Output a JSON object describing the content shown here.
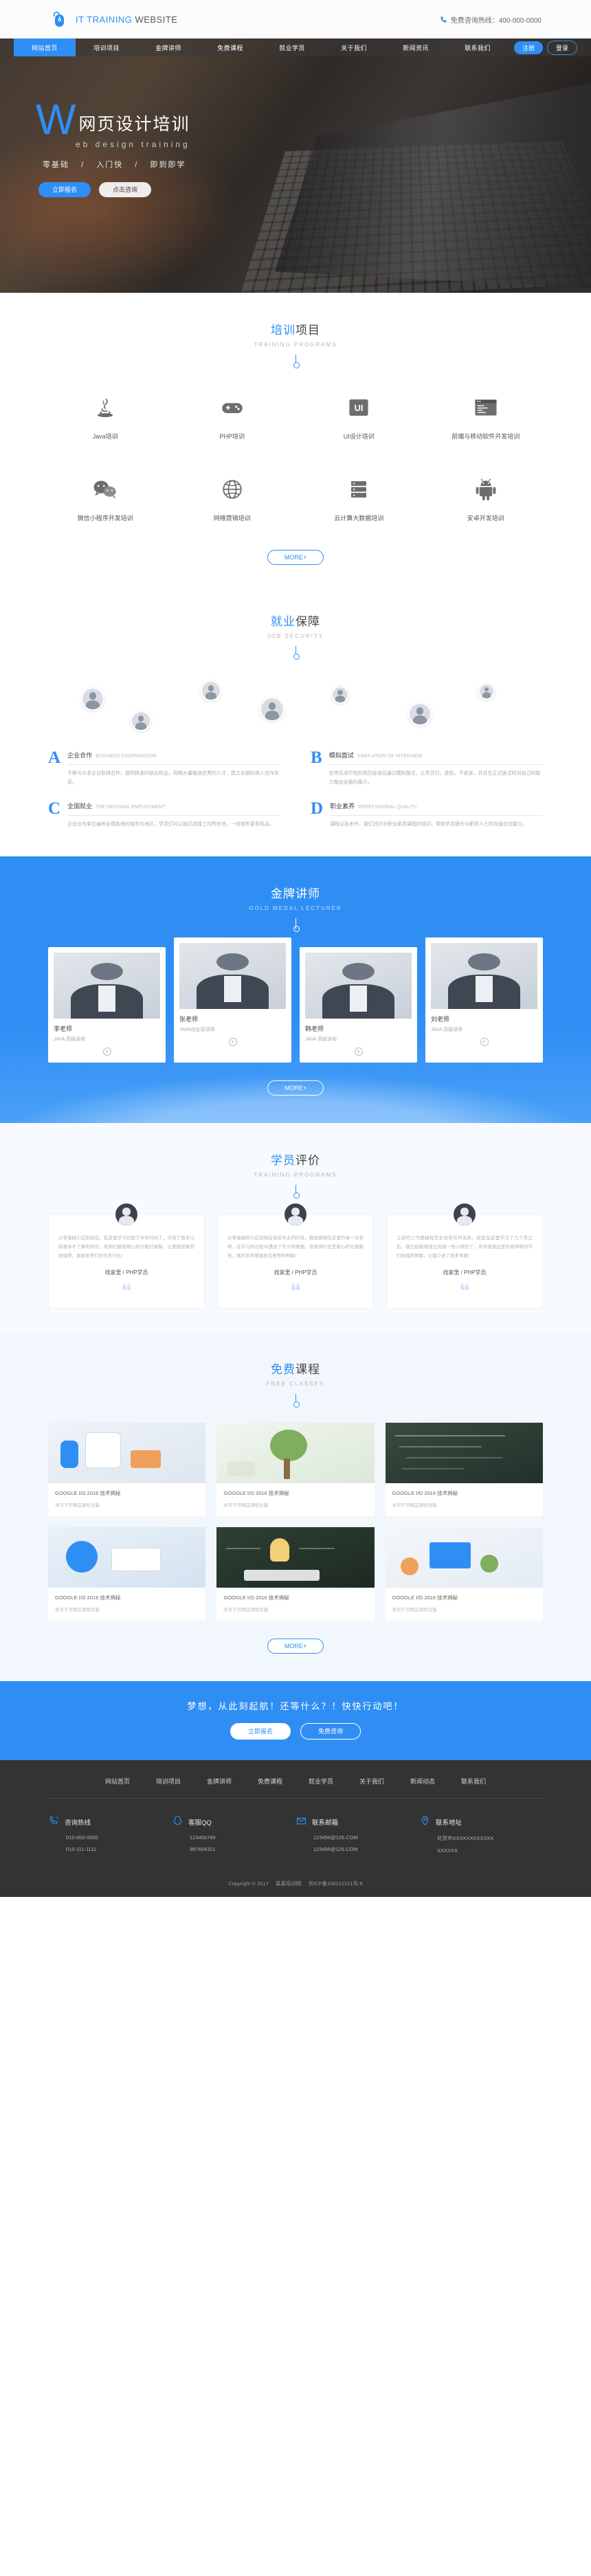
{
  "header": {
    "brand_primary": "IT TRAINING",
    "brand_secondary": "WEBSITE",
    "hotline_label": "免费咨询热线：400-000-0000",
    "phone_icon": "phone-icon",
    "logo_icon": "mouse-logo-icon"
  },
  "nav": {
    "items": [
      {
        "label": "网站首页",
        "active": true
      },
      {
        "label": "培训项目",
        "active": false
      },
      {
        "label": "金牌讲师",
        "active": false
      },
      {
        "label": "免费课程",
        "active": false
      },
      {
        "label": "就业学员",
        "active": false
      },
      {
        "label": "关于我们",
        "active": false
      },
      {
        "label": "新闻资讯",
        "active": false
      },
      {
        "label": "联系我们",
        "active": false
      }
    ],
    "register_label": "注册",
    "login_label": "登录"
  },
  "hero": {
    "letter": "W",
    "title_cn": "网页设计培训",
    "subtitle_en": "eb  design  training",
    "tags": [
      "零基础",
      "入门快",
      "即到即学"
    ],
    "tag_sep": "/",
    "btn_primary": "立即报名",
    "btn_secondary": "点击咨询"
  },
  "programs": {
    "title_hl": "培训",
    "title_rest": "项目",
    "title_en": "TRAINING PROGRAMS",
    "items": [
      {
        "name": "Java培训",
        "icon": "java-icon"
      },
      {
        "name": "PHP培训",
        "icon": "php-gamepad-icon"
      },
      {
        "name": "UI设计培训",
        "icon": "ui-icon"
      },
      {
        "name": "前端与移动软件开发培训",
        "icon": "code-window-icon"
      },
      {
        "name": "微信小程序开发培训",
        "icon": "wechat-icon"
      },
      {
        "name": "网络营销培训",
        "icon": "globe-icon"
      },
      {
        "name": "云计算大数据培训",
        "icon": "server-icon"
      },
      {
        "name": "安卓开发培训",
        "icon": "android-icon"
      }
    ],
    "more_label": "MORE+"
  },
  "job_security": {
    "title_hl": "就业",
    "title_rest": "保障",
    "title_en": "JOB SECURITY",
    "items": [
      {
        "letter": "A",
        "name": "企业合作",
        "en": "BUSINESS COOPERATION",
        "desc": "不断与众多企业取得合作，提供精准的就业机会，同期大量输送优秀的人才，建立长期的用人合作关系。"
      },
      {
        "letter": "B",
        "name": "模拟面试",
        "en": "SIMULATION OF INTERVIEW",
        "desc": "在学员进行完的简历投递后通过模拟面试，让学员们，放松，不紧张，并且在正式面试时对自己的能力做出全面的展示。"
      },
      {
        "letter": "C",
        "name": "全国就业",
        "en": "THE NATIONAL EMPLOYMENT",
        "desc": "企业合作单位遍布全国各地的城市与地区，学员们可以就近选择工作所在地，一线城市更多机会。"
      },
      {
        "letter": "D",
        "name": "职业素养",
        "en": "PROFESSIONAL QUALITY",
        "desc": "课程以技术外，我们还针对职业素质课程的培训，帮助学员提升与职场人士的沟通交往能力。"
      }
    ]
  },
  "lecturers": {
    "title": "金牌讲师",
    "title_en": "GOLD MEDAL LECTURER",
    "items": [
      {
        "name": "李老师",
        "role": "JAVA 高级讲师",
        "raised": false
      },
      {
        "name": "张老师",
        "role": "JAVA创业班讲师",
        "raised": true
      },
      {
        "name": "韩老师",
        "role": "JAVA 高级讲师",
        "raised": false
      },
      {
        "name": "刘老师",
        "role": "JAVA 高级讲师",
        "raised": true
      }
    ],
    "arrow_icon": "chevron-down-icon",
    "more_label": "MORE+"
  },
  "reviews": {
    "title_hl": "学员",
    "title_rest": "评价",
    "title_en": "TRAINING PROGRAMS",
    "items": [
      {
        "text": "从零基础小白到现在，在这里学习已经了半年时间了，学到了很多以前根本不了解的知识，老师们都很用心的为我们讲解，让我感觉真的很值得，谢谢老师们的辛苦付出！",
        "name": "找家里 / PHP学员"
      },
      {
        "text": "从零基础的小白到现在接近毕业的阶段，我很感谢在这里的每一位老师，在学习的过程中遇到了不少的难题，但老师们总是耐心的为我解答，真的非常感谢各位老师的帮助！",
        "name": "找家里 / PHP学员"
      },
      {
        "text": "之前的工作跟编程完全没有任何关系，但是在这里学习了几个月之后，我已经能够独立完成一些小项目了，非常感谢这里的老师和同学们给我的帮助，让我少走了很多弯路！",
        "name": "找家里 / PHP学员"
      }
    ],
    "quote_glyph": "❝"
  },
  "classes": {
    "title_hl": "免费",
    "title_rest": "课程",
    "title_en": "FREE CLASSES",
    "items": [
      {
        "title": "GOOGLE I/O 2016 技术揭秘",
        "desc": "本月干货精品课程合集",
        "thumb": "thumb-a"
      },
      {
        "title": "GOOGLE I/O 2016 技术揭秘",
        "desc": "本月干货精品课程合集",
        "thumb": "thumb-b"
      },
      {
        "title": "GOOGLE I/O 2016 技术揭秘",
        "desc": "本月干货精品课程合集",
        "thumb": "thumb-c"
      },
      {
        "title": "GOOGLE I/O 2016 技术揭秘",
        "desc": "本月干货精品课程合集",
        "thumb": "thumb-d"
      },
      {
        "title": "GOOGLE I/O 2016 技术揭秘",
        "desc": "本月干货精品课程合集",
        "thumb": "thumb-e"
      },
      {
        "title": "GOOGLE I/O 2016 技术揭秘",
        "desc": "本月干货精品课程合集",
        "thumb": "thumb-f"
      }
    ],
    "more_label": "MORE+"
  },
  "cta": {
    "text": "梦想，从此刻起航！还等什么？！快快行动吧！",
    "btn_primary": "立即报名",
    "btn_secondary": "免费咨询"
  },
  "footer": {
    "nav": [
      "网站首页",
      "培训项目",
      "金牌讲师",
      "免费课程",
      "就业学员",
      "关于我们",
      "新闻动态",
      "联系我们"
    ],
    "columns": [
      {
        "icon": "phone-outline-icon",
        "title": "咨询热线",
        "lines": [
          "010-000-0000",
          "010-111-1111"
        ]
      },
      {
        "icon": "qq-penguin-icon",
        "title": "客服QQ",
        "lines": [
          "123456789",
          "987654321"
        ]
      },
      {
        "icon": "mail-icon",
        "title": "联系邮箱",
        "lines": [
          "123456@126.COM",
          "123456@126.COM"
        ]
      },
      {
        "icon": "location-pin-icon",
        "title": "联系地址",
        "lines": [
          "北京市XXXXXXXXXXXX",
          "XXXXXX"
        ]
      }
    ],
    "copyright": "Copyright © 2017",
    "site_name": "某某培训网",
    "icp": "京ICP备100122221号-6"
  },
  "colors": {
    "accent": "#2f8ef4",
    "footer_bg": "#333333",
    "muted": "#b0b0b0"
  }
}
